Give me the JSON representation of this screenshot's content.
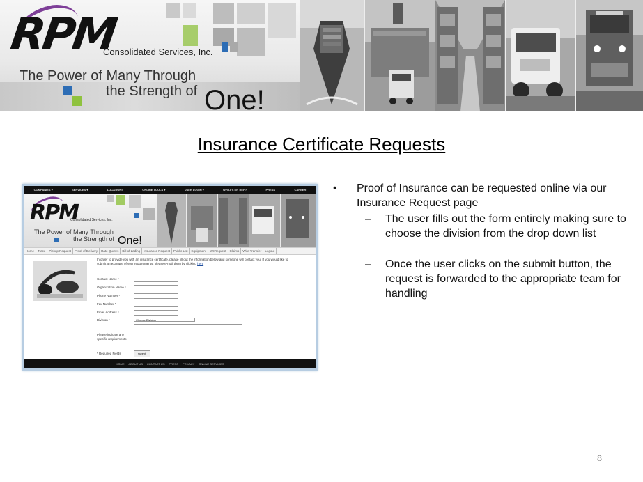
{
  "banner": {
    "logo_text": "RPM",
    "company": "Consolidated Services, Inc.",
    "tagline_line1": "The Power of Many Through",
    "tagline_line2": "the Strength of",
    "tagline_big": "One!"
  },
  "slide": {
    "title": "Insurance Certificate Requests",
    "bullets": [
      {
        "text": "Proof of Insurance can be requested online via our Insurance Request page",
        "sub": [
          "The user fills out the form entirely making sure to choose the division from the drop down list",
          "Once the user clicks on the submit button, the request is forwarded to the appropriate team for handling"
        ]
      }
    ],
    "bullet_symbol": "•",
    "dash_symbol": "–",
    "page_number": "8"
  },
  "embedded_screenshot": {
    "nav": [
      "COMPANIES ▾",
      "SERVICES ▾",
      "LOCATIONS",
      "ONLINE TOOLS ▾",
      "USER LOGIN ▾",
      "WHAT'S MY REP?",
      "PRESS",
      "CAREER"
    ],
    "logo_text": "RPM",
    "company": "Consolidated Services, Inc.",
    "tagline_line1": "The Power of Many Through",
    "tagline_line2": "the Strength of",
    "tagline_big": "One!",
    "tabs": [
      "Home",
      "Trace",
      "Pickup Request",
      "Proof of Delivery",
      "Rate Quotes",
      "Bill of Lading",
      "Insurance Request",
      "Public List",
      "Equipment",
      "W9Request",
      "Claims",
      "Wire Transfer",
      "Logout"
    ],
    "intro_text": "In order to provide you with an insurance certificate, please fill out the information below and someone will contact you. If you would like to submit an example of your requirements, please e-mail them by clicking",
    "intro_link": "here",
    "fields": [
      "Contact Name *",
      "Organization Name *",
      "Phone Number *",
      "Fax Number *",
      "Email Address *",
      "Division *"
    ],
    "division_select": "Choose Division",
    "requirements_label_1": "Please indicate any",
    "requirements_label_2": "specific requirements",
    "required_note": "* Required Fields",
    "submit_label": "submit",
    "footer": [
      "HOME",
      "ABOUT US",
      "CONTACT US",
      "PRESS",
      "PRIVACY",
      "ONLINE SERVICES"
    ]
  },
  "colors": {
    "purple_swoosh": "#7e3f98",
    "green_square": "#8fc23f",
    "blue_square": "#2d6db5",
    "frame_blue": "#b7cde2"
  }
}
